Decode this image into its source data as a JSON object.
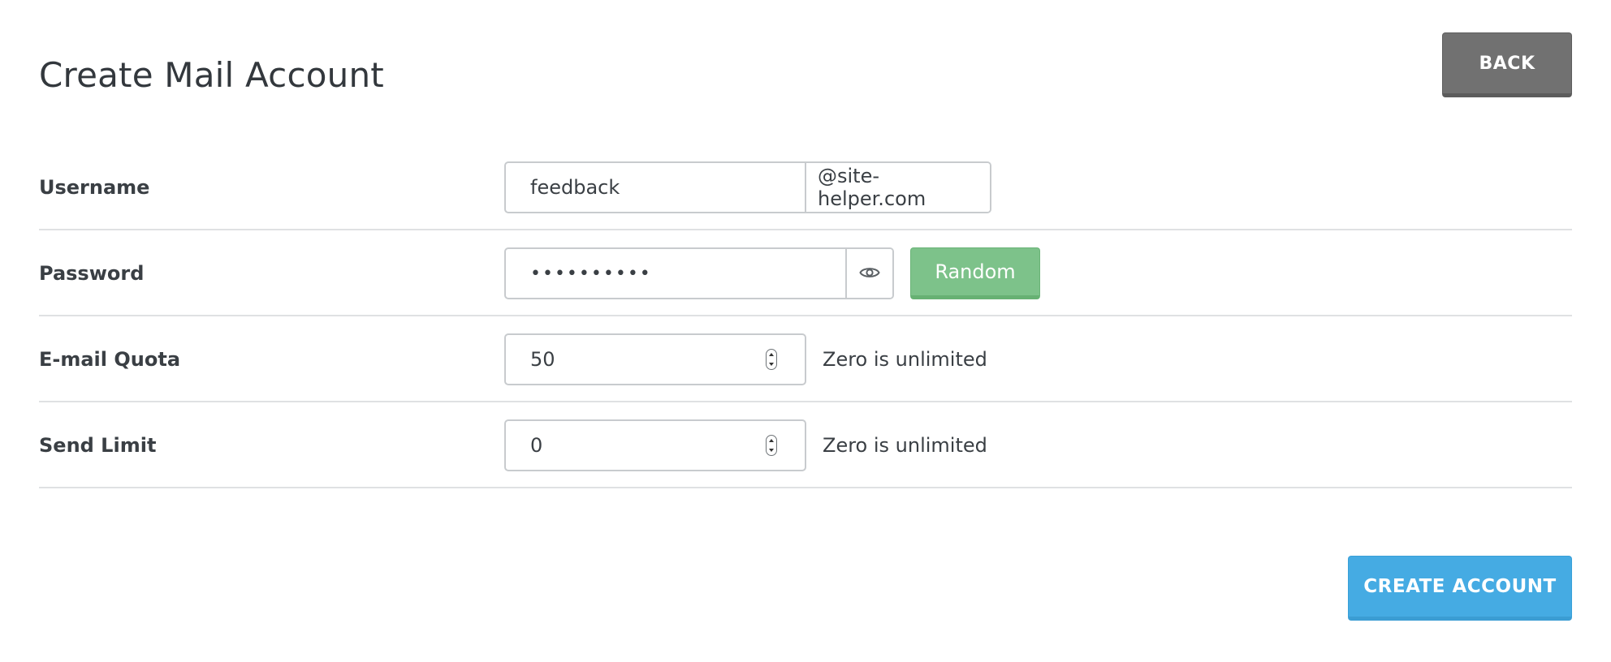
{
  "header": {
    "title": "Create Mail Account",
    "back_label": "BACK"
  },
  "form": {
    "username": {
      "label": "Username",
      "value": "feedback",
      "domain": "@site-helper.com"
    },
    "password": {
      "label": "Password",
      "masked_value": "••••••••••",
      "toggle_icon": "eye-icon",
      "random_label": "Random"
    },
    "email_quota": {
      "label": "E-mail Quota",
      "value": "50",
      "hint": "Zero is unlimited"
    },
    "send_limit": {
      "label": "Send Limit",
      "value": "0",
      "hint": "Zero is unlimited"
    }
  },
  "footer": {
    "create_label": "CREATE ACCOUNT"
  },
  "colors": {
    "back_button": "#717171",
    "random_button": "#7dc28a",
    "create_button": "#45abe3"
  }
}
